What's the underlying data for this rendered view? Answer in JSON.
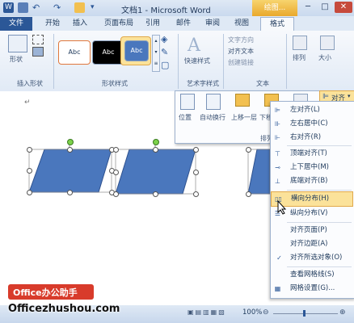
{
  "titlebar": {
    "title": "文档1 - Microsoft Word",
    "context_tab": "绘图...",
    "minimize": "─",
    "maximize": "□",
    "close": "✕"
  },
  "tabs": [
    {
      "label": "文件",
      "active": false
    },
    {
      "label": "开始",
      "active": false
    },
    {
      "label": "插入",
      "active": false
    },
    {
      "label": "页面布局",
      "active": false
    },
    {
      "label": "引用",
      "active": false
    },
    {
      "label": "邮件",
      "active": false
    },
    {
      "label": "审阅",
      "active": false
    },
    {
      "label": "视图",
      "active": false
    },
    {
      "label": "格式",
      "active": true
    }
  ],
  "ribbon": {
    "insert_shapes": {
      "shapes_button": "形状",
      "group_label": "插入形状"
    },
    "shape_styles": {
      "styles": [
        "Abc",
        "Abc",
        "Abc"
      ],
      "group_label": "形状样式"
    },
    "wordart": {
      "quick_styles": "快速样式",
      "group_label": "艺术字样式"
    },
    "text": {
      "direction": "文字方向",
      "align": "对齐文本",
      "link": "创建链接",
      "group_label": "文本"
    },
    "arrange": {
      "label": "排列"
    },
    "size": {
      "label": "大小"
    }
  },
  "arrange_panel": {
    "position": "位置",
    "wrap": "自动换行",
    "bring_forward": "上移一层",
    "send_backward": "下移",
    "group_label": "排列",
    "align_button": "对齐"
  },
  "align_menu": {
    "items": [
      {
        "label": "左对齐(L)",
        "icon": "align-left-icon",
        "glyph": "⊫"
      },
      {
        "label": "左右居中(C)",
        "icon": "align-center-icon",
        "glyph": "⊪"
      },
      {
        "label": "右对齐(R)",
        "icon": "align-right-icon",
        "glyph": "⊩"
      },
      {
        "label": "顶端对齐(T)",
        "icon": "align-top-icon",
        "glyph": "⊤"
      },
      {
        "label": "上下居中(M)",
        "icon": "align-middle-icon",
        "glyph": "⊸"
      },
      {
        "label": "底端对齐(B)",
        "icon": "align-bottom-icon",
        "glyph": "⊥"
      },
      {
        "label": "横向分布(H)",
        "icon": "distribute-horizontal-icon",
        "glyph": "▯▯",
        "highlighted": true
      },
      {
        "label": "纵向分布(V)",
        "icon": "distribute-vertical-icon",
        "glyph": "☰"
      },
      {
        "label": "对齐页面(P)",
        "icon": "",
        "glyph": ""
      },
      {
        "label": "对齐边距(A)",
        "icon": "",
        "glyph": ""
      },
      {
        "label": "对齐所选对象(O)",
        "icon": "checkmark-icon",
        "glyph": "✓"
      },
      {
        "label": "查看网格线(S)",
        "icon": "",
        "glyph": ""
      },
      {
        "label": "网格设置(G)...",
        "icon": "grid-icon",
        "glyph": "▦"
      }
    ]
  },
  "status": {
    "zoom": "100%"
  },
  "watermark": {
    "brand": "Office办公助手",
    "url": "Officezhushou.com"
  },
  "colors": {
    "accent": "#2b5797",
    "shape_fill": "#4a77bd",
    "highlight": "#fbe29a",
    "brand_red": "#d83b2b"
  }
}
